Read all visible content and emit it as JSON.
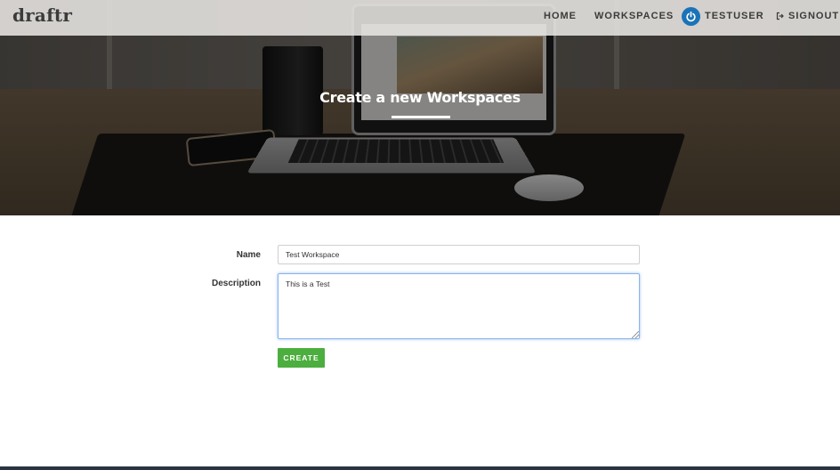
{
  "app": {
    "brand": "draftr"
  },
  "nav": {
    "home": "HOME",
    "workspaces": "WORKSPACES",
    "user": "TESTUSER",
    "user_icon": "power-icon",
    "signout": "SIGNOUT",
    "signout_icon": "sign-out-icon"
  },
  "hero": {
    "title": "Create a new Workspaces"
  },
  "form": {
    "name_label": "Name",
    "name_value": "Test Workspace",
    "description_label": "Description",
    "description_value": "This is a Test",
    "create_label": "CREATE"
  },
  "colors": {
    "accent_green": "#4cae3e",
    "user_icon_blue": "#1a73b8",
    "focus_blue": "#8ab4e8"
  }
}
